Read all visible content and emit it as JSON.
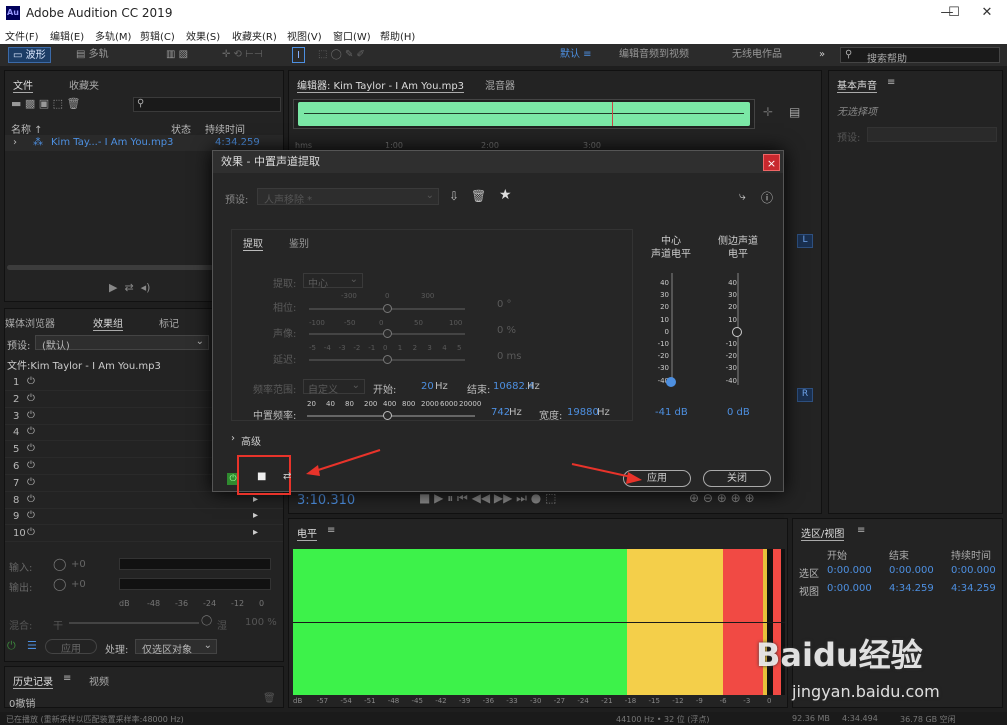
{
  "app": {
    "title": "Adobe Audition CC 2019",
    "logo": "Au"
  },
  "window_controls": {
    "minimize": "—",
    "maximize": "☐",
    "close": "✕"
  },
  "menu": [
    "文件(F)",
    "编辑(E)",
    "多轨(M)",
    "剪辑(C)",
    "效果(S)",
    "收藏夹(R)",
    "视图(V)",
    "窗口(W)",
    "帮助(H)"
  ],
  "toolbar": {
    "waveform": "波形",
    "multitrack": "多轨",
    "workspace_default": "默认",
    "workspace_edit_video": "编辑音频到视频",
    "workspace_wireless": "无线电作品",
    "search_placeholder": "搜索帮助"
  },
  "files_panel": {
    "tab_files": "文件",
    "tab_favorites": "收藏夹",
    "col_name": "名称 ↑",
    "col_status": "状态",
    "col_duration": "持续时间",
    "file_name": "Kim Tay...- I Am You.mp3",
    "file_duration": "4:34.259"
  },
  "effects_panel": {
    "tab_media": "媒体浏览器",
    "tab_rack": "效果组",
    "tab_markers": "标记",
    "preset_label": "预设:",
    "preset_value": "(默认)",
    "file_label": "文件:Kim Taylor - I Am You.mp3",
    "slots": [
      "1",
      "2",
      "3",
      "4",
      "5",
      "6",
      "7",
      "8",
      "9",
      "10"
    ],
    "input_label": "输入:",
    "output_label": "输出:",
    "gain": "+0",
    "db_scale": [
      "dB",
      "-48",
      "-36",
      "-24",
      "-12",
      "0"
    ],
    "mix_label": "混合:",
    "mix_dry": "干",
    "mix_wet": "湿",
    "mix_value": "100 %",
    "apply": "应用",
    "process_label": "处理:",
    "process_value": "仅选区对象"
  },
  "history": {
    "tab_history": "历史记录",
    "tab_video": "视频",
    "undo": "0撤销"
  },
  "editor": {
    "tab_editor": "编辑器: Kim Taylor - I Am You.mp3",
    "tab_mixer": "混音器",
    "ruler": [
      "hms",
      "1:00",
      "2:00",
      "3:00"
    ],
    "time": "3:10.310"
  },
  "essential_sound": {
    "title": "基本声音",
    "no_selection": "无选择项",
    "preset_label": "预设:"
  },
  "levels": {
    "title": "电平",
    "scale": [
      "dB",
      "-57",
      "-54",
      "-51",
      "-48",
      "-45",
      "-42",
      "-39",
      "-36",
      "-33",
      "-30",
      "-27",
      "-24",
      "-21",
      "-18",
      "-15",
      "-12",
      "-9",
      "-6",
      "-3",
      "0"
    ]
  },
  "selection_view": {
    "title": "选区/视图",
    "col_start": "开始",
    "col_end": "结束",
    "col_duration": "持续时间",
    "row_selection": "选区",
    "row_view": "视图",
    "sel_start": "0:00.000",
    "sel_end": "0:00.000",
    "sel_duration": "0:00.000",
    "view_start": "0:00.000",
    "view_end": "4:34.259",
    "view_duration": "4:34.259"
  },
  "status_bar": {
    "left": "已在播放 (重新采样以匹配装置采样率:48000 Hz)",
    "sample": "44100 Hz • 32 位 (浮点)",
    "size": "92.36 MB",
    "duration": "4:34.494",
    "free": "36.78 GB 空闲"
  },
  "modal": {
    "title": "效果 - 中置声道提取",
    "close": "×",
    "preset_label": "预设:",
    "preset_value": "人声移除 *",
    "tab_extract": "提取",
    "tab_discrimination": "鉴别",
    "extract_label": "提取:",
    "extract_value": "中心",
    "phase_label": "相位:",
    "phase_ticks": [
      "-300",
      "0",
      "300"
    ],
    "phase_value": "0 °",
    "pan_label": "声像:",
    "pan_ticks": [
      "-100",
      "-50",
      "0",
      "50",
      "100"
    ],
    "pan_value": "0 %",
    "delay_label": "延迟:",
    "delay_ticks": [
      "-5",
      "-4",
      "-3",
      "-2",
      "-1",
      "0",
      "1",
      "2",
      "3",
      "4",
      "5"
    ],
    "delay_value": "0 ms",
    "freq_range_label": "频率范围:",
    "freq_range_value": "自定义",
    "start_label": "开始:",
    "start_value": "20",
    "start_unit": "Hz",
    "end_label": "结束:",
    "end_value": "10682.4",
    "end_unit": "Hz",
    "crossover_label": "中置频率:",
    "crossover_ticks": [
      "20",
      "40",
      "80",
      "200",
      "400",
      "800",
      "2000",
      "6000",
      "20000"
    ],
    "crossover_value": "742",
    "crossover_unit": "Hz",
    "width_label": "宽度:",
    "width_value": "19880",
    "width_unit": "Hz",
    "center_level_title": "中心\n声道电平",
    "side_level_title": "侧边声道\n电平",
    "level_scale": [
      "40",
      "30",
      "20",
      "10",
      "0",
      "-10",
      "-20",
      "-30",
      "-40"
    ],
    "center_level_value": "-41 dB",
    "side_level_value": "0 dB",
    "advanced": "高级",
    "apply": "应用",
    "close_btn": "关闭"
  },
  "watermark": {
    "brand": "Baidu经验",
    "url": "jingyan.baidu.com"
  },
  "colors": {
    "accent": "#4d8fe0",
    "meter_green": "#3df24a",
    "meter_yellow": "#f4cf4a",
    "meter_red": "#f14a44",
    "annotation_red": "#e8332a"
  }
}
